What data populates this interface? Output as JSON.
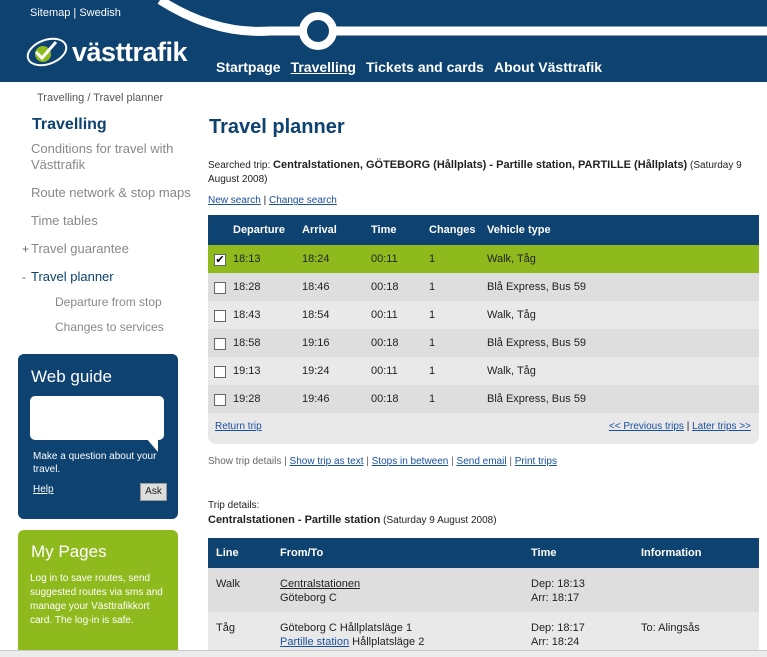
{
  "header": {
    "links": [
      "Sitemap",
      "Swedish"
    ],
    "link_separator": "|",
    "logo_text": "västtrafik",
    "nav": [
      "Startpage",
      "Travelling",
      "Tickets and cards",
      "About Västtrafik"
    ],
    "active_nav": "Travelling",
    "colors": {
      "brand_blue": "#0d4271",
      "accent_green": "#8fba1e"
    }
  },
  "breadcrumb": "Travelling / Travel planner",
  "sidebar": {
    "heading": "Travelling",
    "items": [
      {
        "label": "Conditions for travel with Västtrafik"
      },
      {
        "label": "Route network & stop maps"
      },
      {
        "label": "Time tables"
      },
      {
        "label": "Travel guarantee",
        "prefix": "+"
      },
      {
        "label": "Travel planner",
        "prefix": "-"
      }
    ],
    "subitems": [
      "Departure from stop",
      "Changes to services"
    ]
  },
  "webguide": {
    "title": "Web guide",
    "text": "Make a question about your travel.",
    "help": "Help",
    "ask": "Ask"
  },
  "mypages": {
    "title": "My Pages",
    "text": "Log in to save routes, send suggested routes via sms and manage your Västtrafikkort card. The log-in is safe."
  },
  "main": {
    "title": "Travel planner",
    "searched_label": "Searched trip:",
    "searched_trip": "Centralstationen, GÖTEBORG (Hållplats) - Partille station, PARTILLE (Hållplats)",
    "searched_date": "(Saturday 9 August 2008)",
    "new_search": "New search",
    "change_search": "Change search",
    "separator": "|"
  },
  "trips": {
    "columns": [
      "Departure",
      "Arrival",
      "Time",
      "Changes",
      "Vehicle type"
    ],
    "rows": [
      {
        "departure": "18:13",
        "arrival": "18:24",
        "time": "00:11",
        "changes": "1",
        "vehicle": "Walk, Tåg",
        "checked": true,
        "check_mark": "✔"
      },
      {
        "departure": "18:28",
        "arrival": "18:46",
        "time": "00:18",
        "changes": "1",
        "vehicle": "Blå Express, Bus 59",
        "checked": false,
        "check_mark": ""
      },
      {
        "departure": "18:43",
        "arrival": "18:54",
        "time": "00:11",
        "changes": "1",
        "vehicle": "Walk, Tåg",
        "checked": false,
        "check_mark": ""
      },
      {
        "departure": "18:58",
        "arrival": "19:16",
        "time": "00:18",
        "changes": "1",
        "vehicle": "Blå Express, Bus 59",
        "checked": false,
        "check_mark": ""
      },
      {
        "departure": "19:13",
        "arrival": "19:24",
        "time": "00:11",
        "changes": "1",
        "vehicle": "Walk, Tåg",
        "checked": false,
        "check_mark": ""
      },
      {
        "departure": "19:28",
        "arrival": "19:46",
        "time": "00:18",
        "changes": "1",
        "vehicle": "Blå Express, Bus 59",
        "checked": false,
        "check_mark": ""
      }
    ],
    "return_trip": "Return trip",
    "previous": "<< Previous trips",
    "later": "Later trips >>",
    "separator": "|"
  },
  "actions": {
    "show_details": "Show trip details",
    "as_text": "Show trip as text",
    "stops_between": "Stops in between",
    "send_email": "Send email",
    "print": "Print trips",
    "separator": "|"
  },
  "details": {
    "label": "Trip details:",
    "title": "Centralstationen - Partille station",
    "date": "(Saturday 9 August 2008)",
    "columns": [
      "Line",
      "From/To",
      "Time",
      "Information"
    ],
    "rows": [
      {
        "line": "Walk",
        "from_link": "Centralstationen",
        "to_text": "Göteborg C",
        "dep": "Dep: 18:13",
        "arr": "Arr: 18:17",
        "info": ""
      },
      {
        "line": "Tåg",
        "from_text": "Göteborg C Hållplatsläge 1",
        "to_link": "Partille station",
        "to_suffix": "Hållplatsläge 2",
        "dep": "Dep: 18:17",
        "arr": "Arr: 18:24",
        "info": "To: Alingsås"
      }
    ]
  }
}
